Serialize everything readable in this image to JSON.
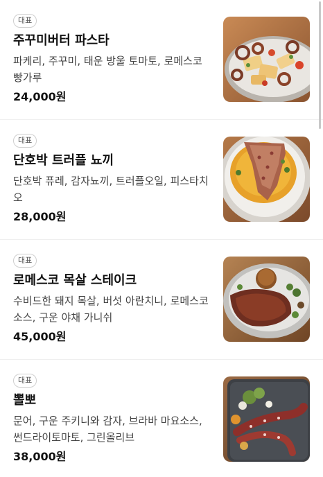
{
  "menu": {
    "items": [
      {
        "badge": "대표",
        "name": "주꾸미버터 파스타",
        "description": "파케리, 주꾸미, 태운 방울 토마토, 로메스코 빵가루",
        "price": "24,000원",
        "image_icon": "pasta-dish-photo"
      },
      {
        "badge": "대표",
        "name": "단호박 트러플 뇨끼",
        "description": "단호박 퓨레, 감자뇨끼, 트러플오일, 피스타치오",
        "price": "28,000원",
        "image_icon": "gnocchi-dish-photo"
      },
      {
        "badge": "대표",
        "name": "로메스코 목살 스테이크",
        "description": "수비드한 돼지 목살, 버섯 아란치니, 로메스코소스, 구운 야채 가니쉬",
        "price": "45,000원",
        "image_icon": "steak-dish-photo"
      },
      {
        "badge": "대표",
        "name": "뽈뽀",
        "description": "문어, 구운 주키니와 감자, 브라바 마요소스, 썬드라이토마토, 그린올리브",
        "price": "38,000원",
        "image_icon": "octopus-dish-photo"
      }
    ]
  }
}
